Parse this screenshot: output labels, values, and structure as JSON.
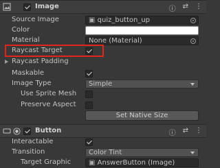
{
  "image_component": {
    "title": "Image",
    "rows": {
      "source_image": {
        "label": "Source Image",
        "value": "quiz_button_up"
      },
      "color": {
        "label": "Color"
      },
      "material": {
        "label": "Material",
        "value": "None (Material)"
      },
      "raycast_target": {
        "label": "Raycast Target",
        "checked": true
      },
      "raycast_padding": {
        "label": "Raycast Padding"
      },
      "maskable": {
        "label": "Maskable",
        "checked": true
      },
      "image_type": {
        "label": "Image Type",
        "value": "Simple"
      },
      "use_sprite_mesh": {
        "label": "Use Sprite Mesh",
        "checked": false
      },
      "preserve_aspect": {
        "label": "Preserve Aspect",
        "checked": false
      }
    },
    "set_native_size_label": "Set Native Size",
    "color_value": "#ffffff"
  },
  "button_component": {
    "title": "Button",
    "rows": {
      "interactable": {
        "label": "Interactable",
        "checked": true
      },
      "transition": {
        "label": "Transition",
        "value": "Color Tint"
      },
      "target_graphic": {
        "label": "Target Graphic",
        "value": "AnswerButton (Image)"
      }
    }
  },
  "header_icons": [
    "help-icon",
    "presets-icon",
    "kebab-menu-icon"
  ],
  "highlight_color": "#e3261d"
}
